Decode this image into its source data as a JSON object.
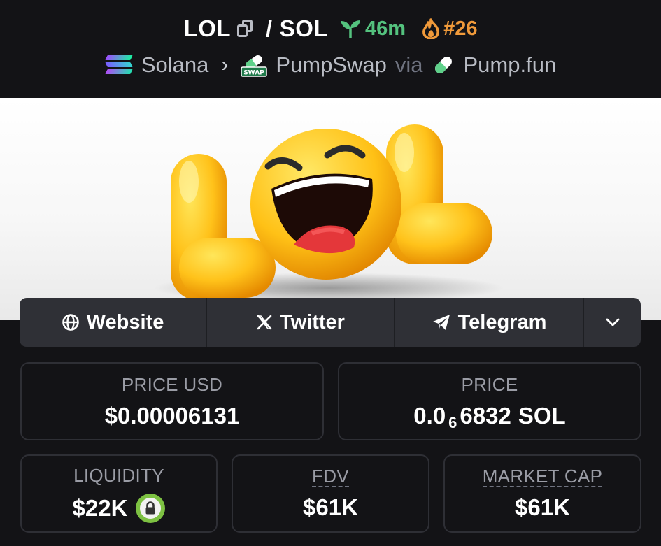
{
  "header": {
    "base_token": "LOL",
    "separator": "/",
    "quote_token": "SOL",
    "age": "46m",
    "rank": "#26",
    "chain": "Solana",
    "dex": "PumpSwap",
    "via_label": "via",
    "launchpad": "Pump.fun",
    "swap_badge_text": "SWAP"
  },
  "banner": {
    "image": "LOL laughing emoji token banner",
    "logo_letters": "LOL"
  },
  "social": {
    "website_label": "Website",
    "twitter_label": "Twitter",
    "telegram_label": "Telegram"
  },
  "stats": {
    "price_usd_label": "PRICE USD",
    "price_usd_value": "$0.00006131",
    "price_label": "PRICE",
    "price_prefix": "0.0",
    "price_zero_count": "6",
    "price_digits": "6832",
    "price_unit": "SOL",
    "liquidity_label": "LIQUIDITY",
    "liquidity_value": "$22K",
    "fdv_label": "FDV",
    "fdv_value": "$61K",
    "market_cap_label": "MARKET CAP",
    "market_cap_value": "$61K"
  },
  "colors": {
    "background": "#131316",
    "age_green": "#54c27e",
    "rank_orange": "#f09a3a",
    "lock_green": "#7dc142",
    "button_bg": "#2f3036"
  },
  "icons": [
    "copy-icon",
    "seedling-icon",
    "flame-icon",
    "solana-logo-icon",
    "chevron-right-icon",
    "pumpswap-logo-icon",
    "pumpfun-pill-icon",
    "globe-icon",
    "x-icon",
    "telegram-icon",
    "chevron-down-icon",
    "lock-icon"
  ]
}
